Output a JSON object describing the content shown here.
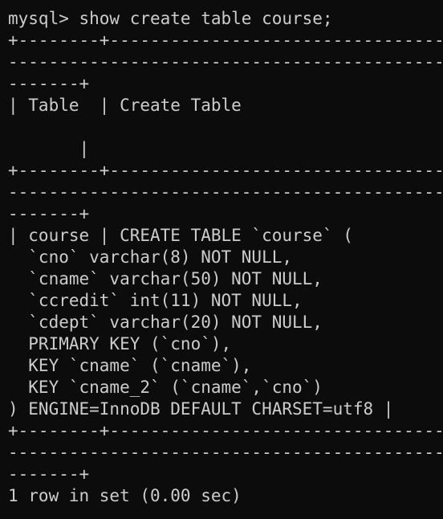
{
  "terminal": {
    "lines": [
      "mysql> show create table course;",
      "+--------+--------------------------------------------",
      "------------------------------------------------------",
      "-------+",
      "| Table  | Create Table",
      "",
      "       |",
      "+--------+--------------------------------------------",
      "------------------------------------------------------",
      "-------+",
      "| course | CREATE TABLE `course` (",
      "  `cno` varchar(8) NOT NULL,",
      "  `cname` varchar(50) NOT NULL,",
      "  `ccredit` int(11) NOT NULL,",
      "  `cdept` varchar(20) NOT NULL,",
      "  PRIMARY KEY (`cno`),",
      "  KEY `cname` (`cname`),",
      "  KEY `cname_2` (`cname`,`cno`)",
      ") ENGINE=InnoDB DEFAULT CHARSET=utf8 |",
      "+--------+--------------------------------------------",
      "------------------------------------------------------",
      "-------+",
      "1 row in set (0.00 sec)"
    ]
  }
}
